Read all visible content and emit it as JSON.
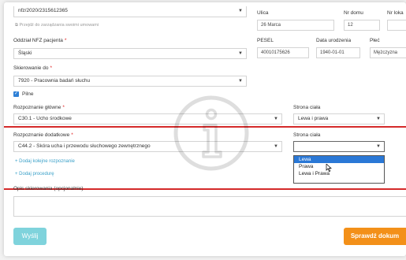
{
  "top": {
    "nfz_number": "nfz/2020/2315612365",
    "hint": "Przejdź do zarządzania swoimi umowami",
    "street_label": "Ulica",
    "street_value": "26 Marca",
    "house_label": "Nr domu",
    "house_value": "12",
    "apt_label": "Nr loka"
  },
  "branch": {
    "label": "Oddział NFZ pacjenta",
    "value": "Śląski"
  },
  "patient": {
    "pesel_label": "PESEL",
    "pesel_value": "40010175626",
    "dob_label": "Data urodzenia",
    "dob_value": "1940-01-01",
    "sex_label": "Płeć",
    "sex_value": "Mężczyzna"
  },
  "referral": {
    "label": "Skierowanie do",
    "value": "7920 - Pracownia badań słuchu",
    "urgent_label": "Pilne"
  },
  "diagnosis_main": {
    "label": "Rozpoznanie główne",
    "value": "C30.1 - Ucho środkowe",
    "side_label": "Strona ciała",
    "side_value": "Lewa i prawa"
  },
  "diagnosis_extra": {
    "label": "Rozpoznanie dodatkowe",
    "value": "C44.2 - Skóra ucha i przewodu słuchowego zewnętrznego",
    "side_label": "Strona ciała",
    "side_options": [
      "Lewa",
      "Prawa",
      "Lewa i Prawa"
    ],
    "side_selected": "Lewa"
  },
  "links": {
    "add_diagnosis": "+ Dodaj kolejne rozpoznanie",
    "add_procedure": "+ Dodaj procedurę"
  },
  "description": {
    "label": "Opis skierowania (opcjonalnie)"
  },
  "buttons": {
    "send": "Wyślij",
    "check": "Sprawdź dokum"
  },
  "colors": {
    "accent_red": "#d42a2a",
    "send_button": "#7fd3dc",
    "check_button": "#f39019",
    "link": "#3aa0c8",
    "selected_option": "#2a78d6"
  }
}
